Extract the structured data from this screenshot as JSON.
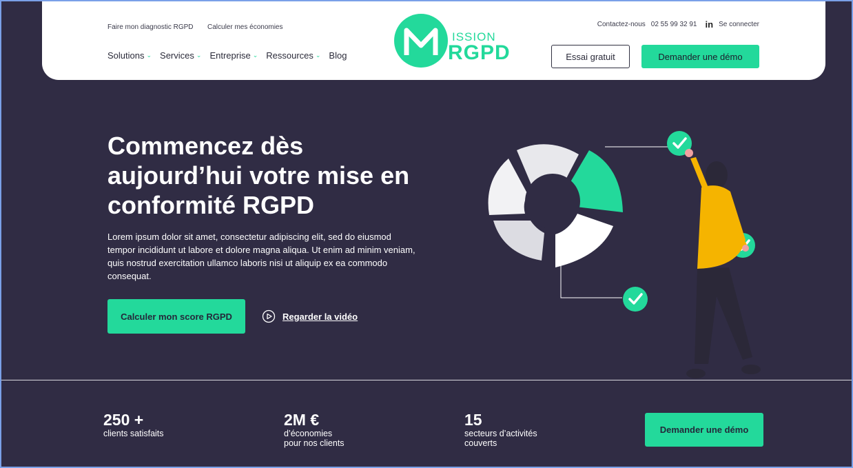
{
  "nav": {
    "top_links": [
      "Faire mon diagnostic RGPD",
      "Calculer mes économies"
    ],
    "menu": [
      {
        "label": "Solutions",
        "has_dropdown": true
      },
      {
        "label": "Services",
        "has_dropdown": true
      },
      {
        "label": "Entreprise",
        "has_dropdown": true
      },
      {
        "label": "Ressources",
        "has_dropdown": true
      },
      {
        "label": "Blog",
        "has_dropdown": false
      }
    ],
    "logo": {
      "letter_part": "ISSION",
      "brand": "RGPD"
    },
    "contact_label": "Contactez-nous",
    "phone": "02 55 99 32 91",
    "linkedin_icon": "in",
    "login_label": "Se connecter",
    "trial_button": "Essai gratuit",
    "demo_button": "Demander une démo"
  },
  "hero": {
    "title": "Commencez dès aujourd’hui votre mise en conformité RGPD",
    "description": "Lorem ipsum dolor sit amet, consectetur adipiscing elit, sed do eiusmod tempor incididunt ut labore et dolore magna aliqua. Ut enim ad minim veniam, quis nostrud exercitation ullamco laboris nisi ut aliquip ex ea commodo consequat.",
    "cta_button": "Calculer mon score RGPD",
    "video_link": "Regarder la vidéo"
  },
  "stats": [
    {
      "value": "250 +",
      "label_lines": [
        "clients satisfaits"
      ]
    },
    {
      "value": "2M €",
      "label_lines": [
        "d’économies",
        "pour nos clients"
      ]
    },
    {
      "value": "15",
      "label_lines": [
        "secteurs d’activités",
        "couverts"
      ]
    }
  ],
  "stats_button": "Demander une démo",
  "colors": {
    "accent": "#23d99b",
    "background": "#302c44",
    "navbar": "#ffffff",
    "figure_shirt": "#f5b400"
  }
}
